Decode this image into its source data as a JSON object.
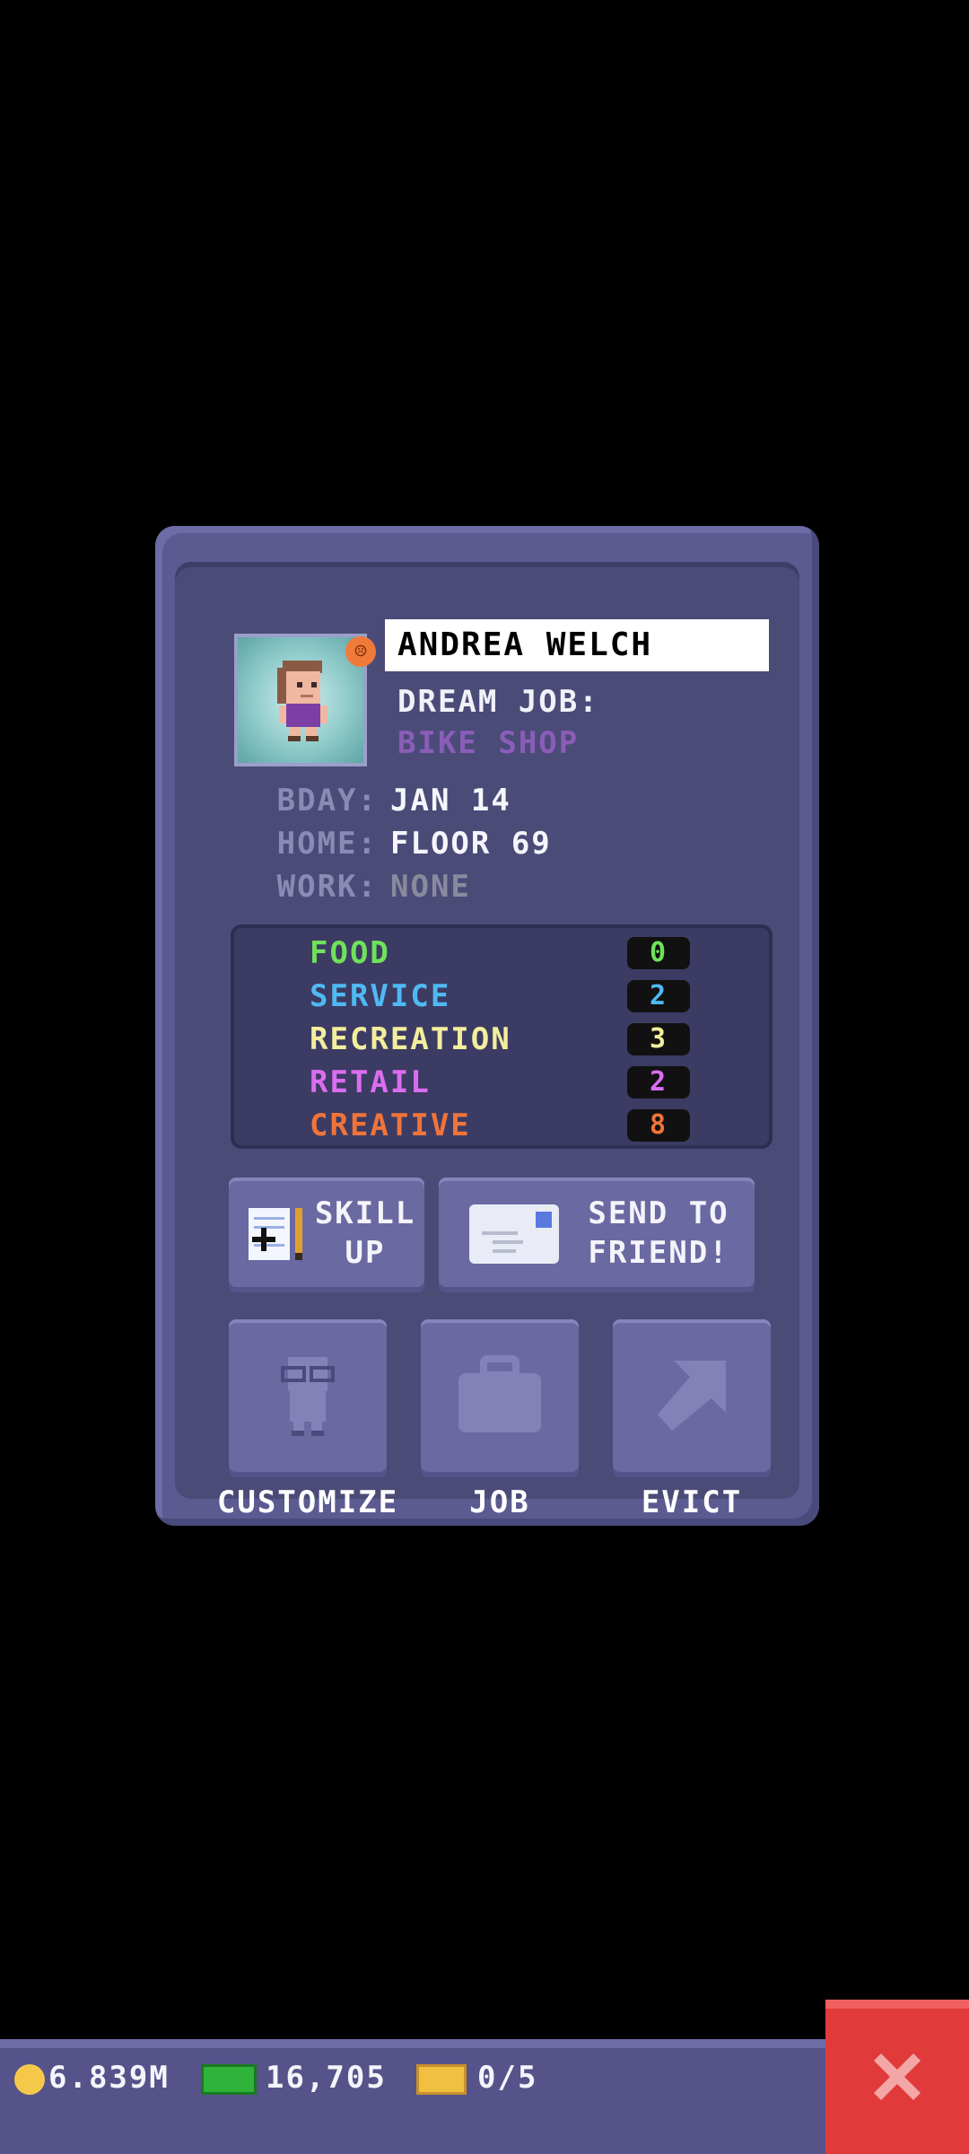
{
  "character": {
    "name": "ANDREA WELCH",
    "dream_job_label": "DREAM JOB:",
    "dream_job_value": "BIKE SHOP",
    "bday_label": "BDAY:",
    "bday_value": "JAN 14",
    "home_label": "HOME:",
    "home_value": "FLOOR 69",
    "work_label": "WORK:",
    "work_value": "NONE"
  },
  "skills": [
    {
      "label": "FOOD",
      "value": "0",
      "color": "#6fe25a"
    },
    {
      "label": "SERVICE",
      "value": "2",
      "color": "#4fb9f3"
    },
    {
      "label": "RECREATION",
      "value": "3",
      "color": "#f3ee9c"
    },
    {
      "label": "RETAIL",
      "value": "2",
      "color": "#db6df0"
    },
    {
      "label": "CREATIVE",
      "value": "8",
      "color": "#f0743a"
    }
  ],
  "buttons": {
    "skill_up_line1": "SKILL",
    "skill_up_line2": "UP",
    "send_line1": "SEND TO",
    "send_line2": "FRIEND!",
    "customize": "CUSTOMIZE",
    "job": "JOB",
    "evict": "EVICT"
  },
  "status_bar": {
    "coins": "6.839M",
    "bux": "16,705",
    "tickets": "0/5"
  }
}
